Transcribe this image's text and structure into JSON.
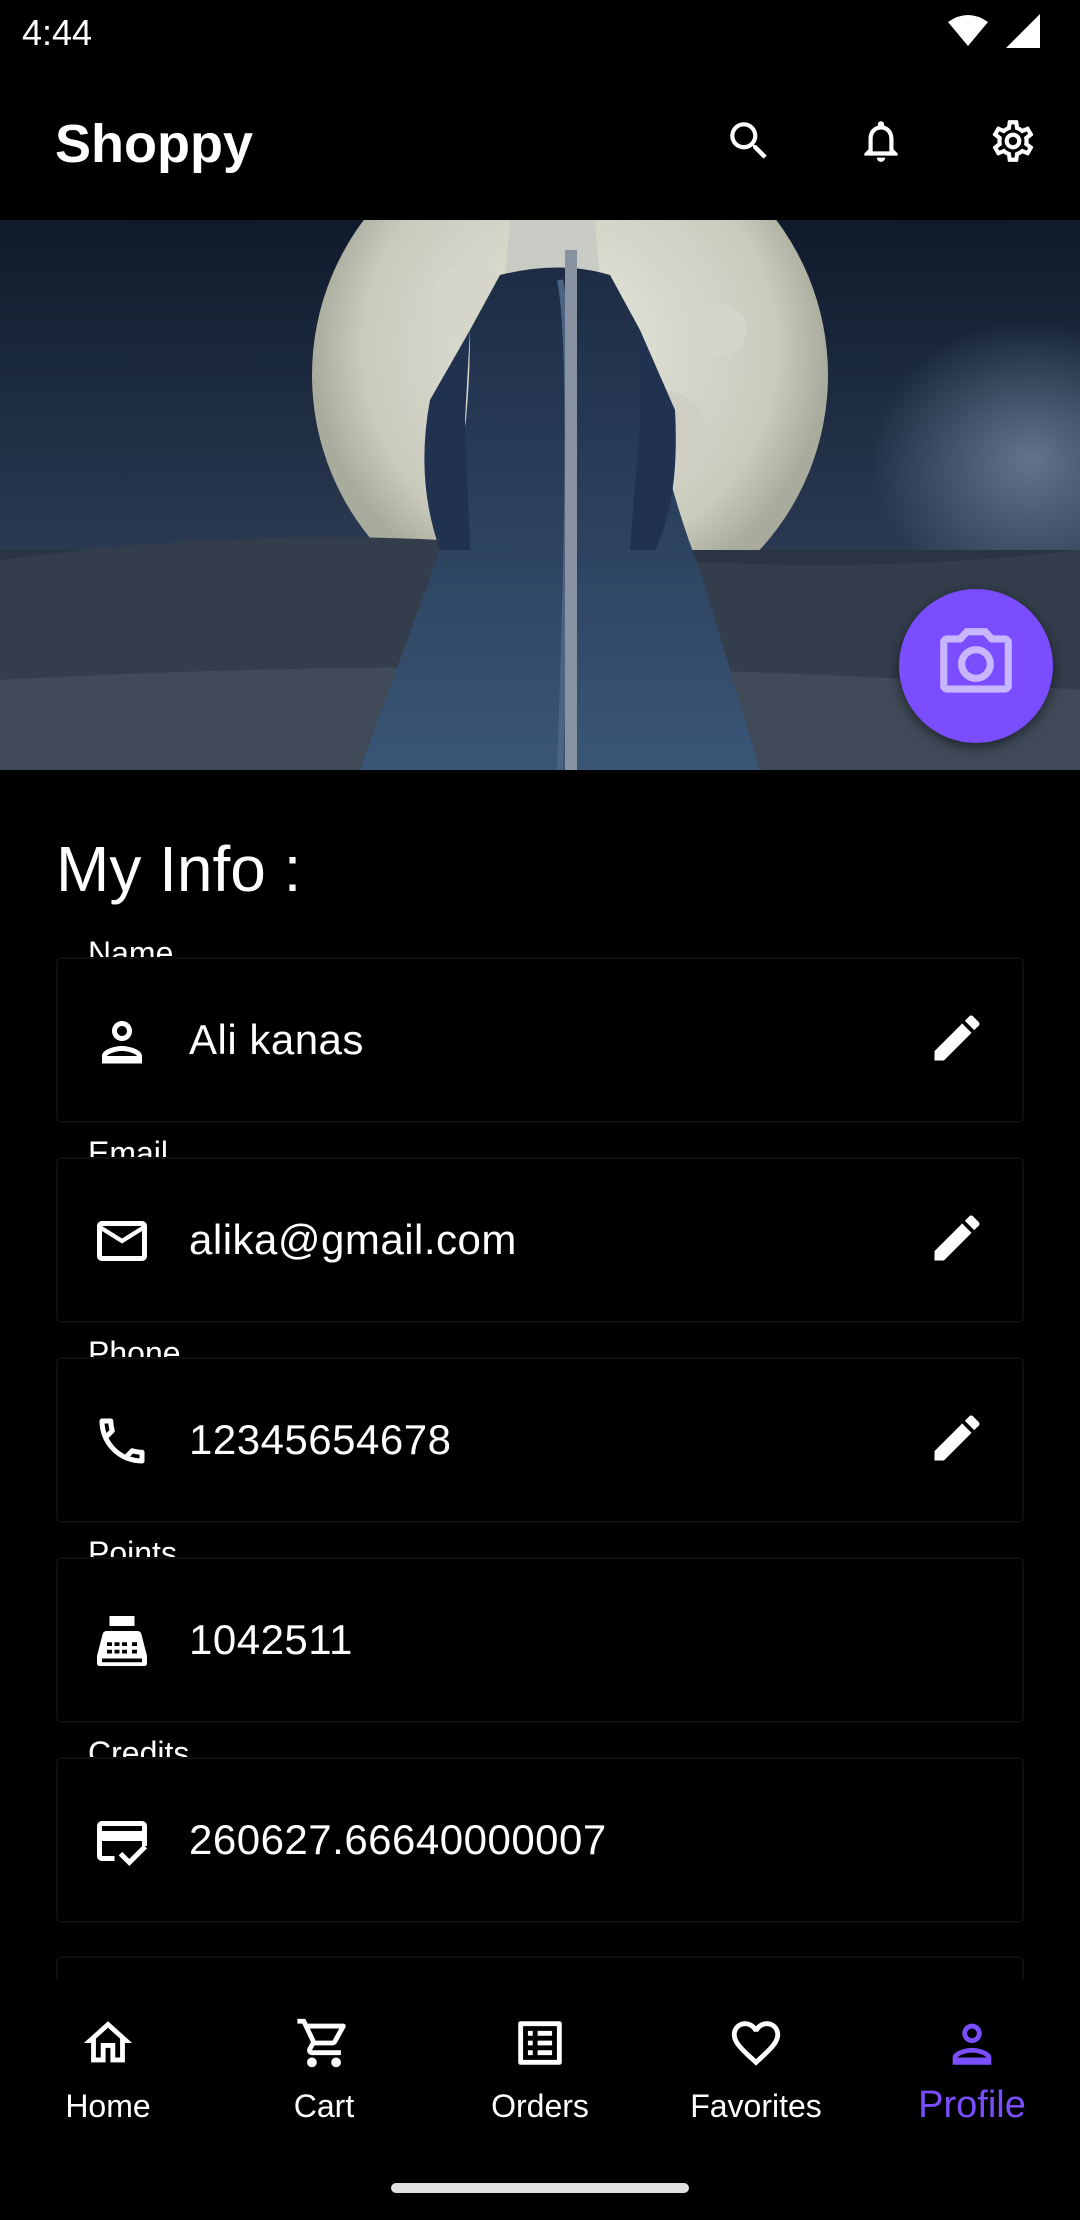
{
  "status_bar": {
    "time": "4:44",
    "icons": [
      "wifi-icon",
      "signal-icon"
    ]
  },
  "app_bar": {
    "title": "Shoppy",
    "actions": [
      "search-icon",
      "bell-icon",
      "gear-icon"
    ]
  },
  "banner": {
    "camera_button_icon": "camera-icon"
  },
  "section_title": "My Info :",
  "fields": {
    "name": {
      "label": "Name",
      "value": "Ali kanas",
      "icon": "person-icon",
      "editable": true
    },
    "email": {
      "label": "Email",
      "value": "alika@gmail.com",
      "icon": "mail-icon",
      "editable": true
    },
    "phone": {
      "label": "Phone",
      "value": "12345654678",
      "icon": "phone-icon",
      "editable": true
    },
    "points": {
      "label": "Points",
      "value": "1042511",
      "icon": "register-icon",
      "editable": false
    },
    "credits": {
      "label": "Credits",
      "value": "260627.66640000007",
      "icon": "credit-card-check-icon",
      "editable": false
    }
  },
  "bottom_nav": {
    "items": [
      {
        "label": "Home",
        "icon": "home-icon"
      },
      {
        "label": "Cart",
        "icon": "cart-icon"
      },
      {
        "label": "Orders",
        "icon": "list-icon"
      },
      {
        "label": "Favorites",
        "icon": "heart-icon"
      },
      {
        "label": "Profile",
        "icon": "person-icon"
      }
    ],
    "active": "Profile"
  },
  "colors": {
    "accent": "#7a4dff",
    "background": "#000000",
    "text": "#ffffff"
  }
}
